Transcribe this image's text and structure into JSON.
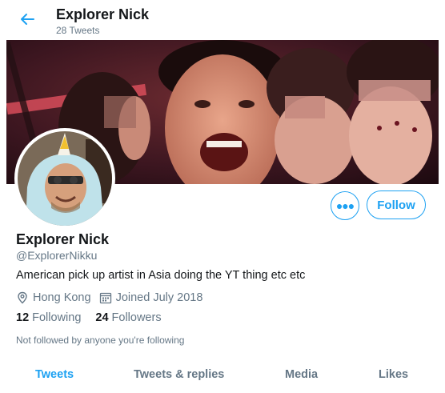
{
  "header": {
    "back_icon": "arrow-left-icon",
    "title": "Explorer Nick",
    "tweet_count": "28 Tweets"
  },
  "actions": {
    "more_icon": "more-options-icon",
    "follow_label": "Follow"
  },
  "profile": {
    "name": "Explorer Nick",
    "handle": "@ExplorerNikku",
    "bio": "American pick up artist in Asia doing the YT thing etc etc",
    "location": "Hong Kong",
    "location_icon": "location-pin-icon",
    "joined": "Joined July 2018",
    "joined_icon": "calendar-icon",
    "following_count": "12",
    "following_label": "Following",
    "followers_count": "24",
    "followers_label": "Followers",
    "followed_by": "Not followed by anyone you're following"
  },
  "tabs": [
    {
      "label": "Tweets",
      "active": true
    },
    {
      "label": "Tweets & replies",
      "active": false
    },
    {
      "label": "Media",
      "active": false
    },
    {
      "label": "Likes",
      "active": false
    }
  ],
  "colors": {
    "accent": "#1da1f2",
    "secondary_text": "#657786",
    "primary_text": "#14171a"
  }
}
